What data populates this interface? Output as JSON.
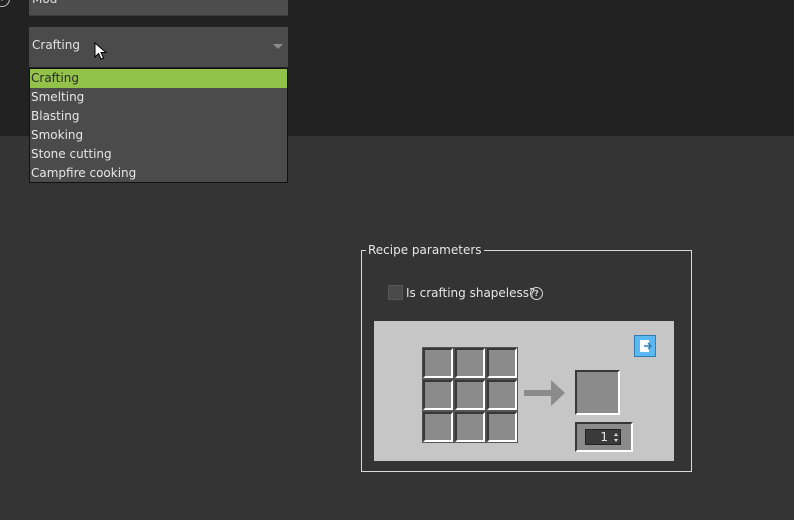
{
  "top": {
    "name_field_value": "Mod",
    "info_icon_glyph": "i"
  },
  "recipe_type_select": {
    "selected": "Crafting",
    "options": [
      "Crafting",
      "Smelting",
      "Blasting",
      "Smoking",
      "Stone cutting",
      "Campfire cooking"
    ],
    "highlight_color": "#92c24a"
  },
  "panel": {
    "title": "Recipe parameters",
    "shapeless_label": "Is crafting shapeless?",
    "shapeless_checked": false,
    "help_glyph": "?",
    "result_quantity": "1"
  },
  "colors": {
    "background": "#343434",
    "top_band": "#222222",
    "recipe_area": "#c6c6c6",
    "slot": "#8b8b8b"
  }
}
